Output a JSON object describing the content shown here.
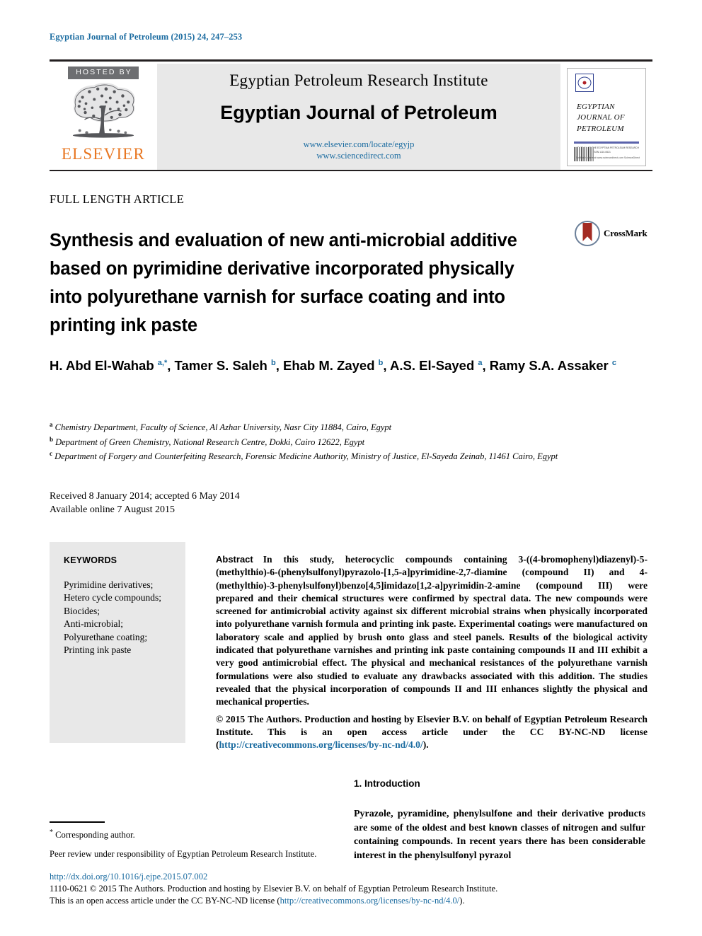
{
  "running_head": "Egyptian Journal of Petroleum (2015) 24, 247–253",
  "masthead": {
    "hosted_by": "HOSTED BY",
    "publisher": "ELSEVIER",
    "institute": "Egyptian Petroleum Research Institute",
    "journal": "Egyptian Journal of Petroleum",
    "link_locate": "www.elsevier.com/locate/egyjp",
    "link_sciencedirect": "www.sciencedirect.com",
    "cover": {
      "line1": "EGYPTIAN",
      "line2": "JOURNAL OF",
      "line3": "PETROLEUM",
      "sub": "A JOURNAL OF THE EGYPTIAN PETROLEUM RESEARCH INSTITUTE EPRI ISSN 1110-0621",
      "sciencedirect_note": "Available online at www.sciencedirect.com ScienceDirect"
    }
  },
  "article_type": "FULL LENGTH ARTICLE",
  "title": "Synthesis and evaluation of new anti-microbial additive based on pyrimidine derivative incorporated physically into polyurethane varnish for surface coating and into printing ink paste",
  "crossmark_label": "CrossMark",
  "authors_html": "H. Abd El-Wahab <sup>a,*</sup>, Tamer S. Saleh <sup>b</sup>, Ehab M. Zayed <sup>b</sup>, A.S. El-Sayed <sup>a</sup>, Ramy S.A. Assaker <sup>c</sup>",
  "affiliations": [
    {
      "marker": "a",
      "text": "Chemistry Department, Faculty of Science, Al Azhar University, Nasr City 11884, Cairo, Egypt"
    },
    {
      "marker": "b",
      "text": "Department of Green Chemistry, National Research Centre, Dokki, Cairo 12622, Egypt"
    },
    {
      "marker": "c",
      "text": "Department of Forgery and Counterfeiting Research, Forensic Medicine Authority, Ministry of Justice, El-Sayeda Zeinab, 11461 Cairo, Egypt"
    }
  ],
  "dates": {
    "received_accepted": "Received 8 January 2014; accepted 6 May 2014",
    "available_online": "Available online 7 August 2015"
  },
  "keywords": {
    "heading": "KEYWORDS",
    "items": [
      "Pyrimidine derivatives;",
      "Hetero cycle compounds;",
      "Biocides;",
      "Anti-microbial;",
      "Polyurethane coating;",
      "Printing ink paste"
    ]
  },
  "abstract": {
    "label": "Abstract",
    "body": "In this study, heterocyclic compounds containing 3-((4-bromophenyl)diazenyl)-5-(methylthio)-6-(phenylsulfonyl)pyrazolo-[1,5-a]pyrimidine-2,7-diamine (compound II) and 4-(methylthio)-3-phenylsulfonyl)benzo[4,5]imidazo[1,2-a]pyrimidin-2-amine (compound III) were prepared and their chemical structures were confirmed by spectral data. The new compounds were screened for antimicrobial activity against six different microbial strains when physically incorporated into polyurethane varnish formula and printing ink paste. Experimental coatings were manufactured on laboratory scale and applied by brush onto glass and steel panels. Results of the biological activity indicated that polyurethane varnishes and printing ink paste containing compounds II and III exhibit a very good antimicrobial effect. The physical and mechanical resistances of the polyurethane varnish formulations were also studied to evaluate any drawbacks associated with this addition. The studies revealed that the physical incorporation of compounds II and III enhances slightly the physical and mechanical properties.",
    "copyright_part1": "© 2015 The Authors. Production and hosting by Elsevier B.V. on behalf of Egyptian Petroleum Research Institute.  This is an open access article under the CC BY-NC-ND license (",
    "copyright_link": "http://creativecommons.org/licenses/by-nc-nd/4.0/",
    "copyright_part2": ")."
  },
  "introduction": {
    "heading": "1. Introduction",
    "body": "Pyrazole, pyramidine, phenylsulfone and their derivative products are some of the oldest and best known classes of nitrogen and sulfur containing compounds. In recent years there has been considerable interest in the phenylsulfonyl pyrazol"
  },
  "footnotes": {
    "corresponding": "Corresponding author.",
    "peer_review": "Peer review under responsibility of Egyptian Petroleum Research Institute."
  },
  "footer": {
    "doi": "http://dx.doi.org/10.1016/j.ejpe.2015.07.002",
    "line1": "1110-0621 © 2015 The Authors. Production and hosting by Elsevier B.V. on behalf of Egyptian Petroleum Research Institute.",
    "line2_pre": "This is an open access article under the CC BY-NC-ND license (",
    "line2_link": "http://creativecommons.org/licenses/by-nc-nd/4.0/",
    "line2_post": ")."
  }
}
